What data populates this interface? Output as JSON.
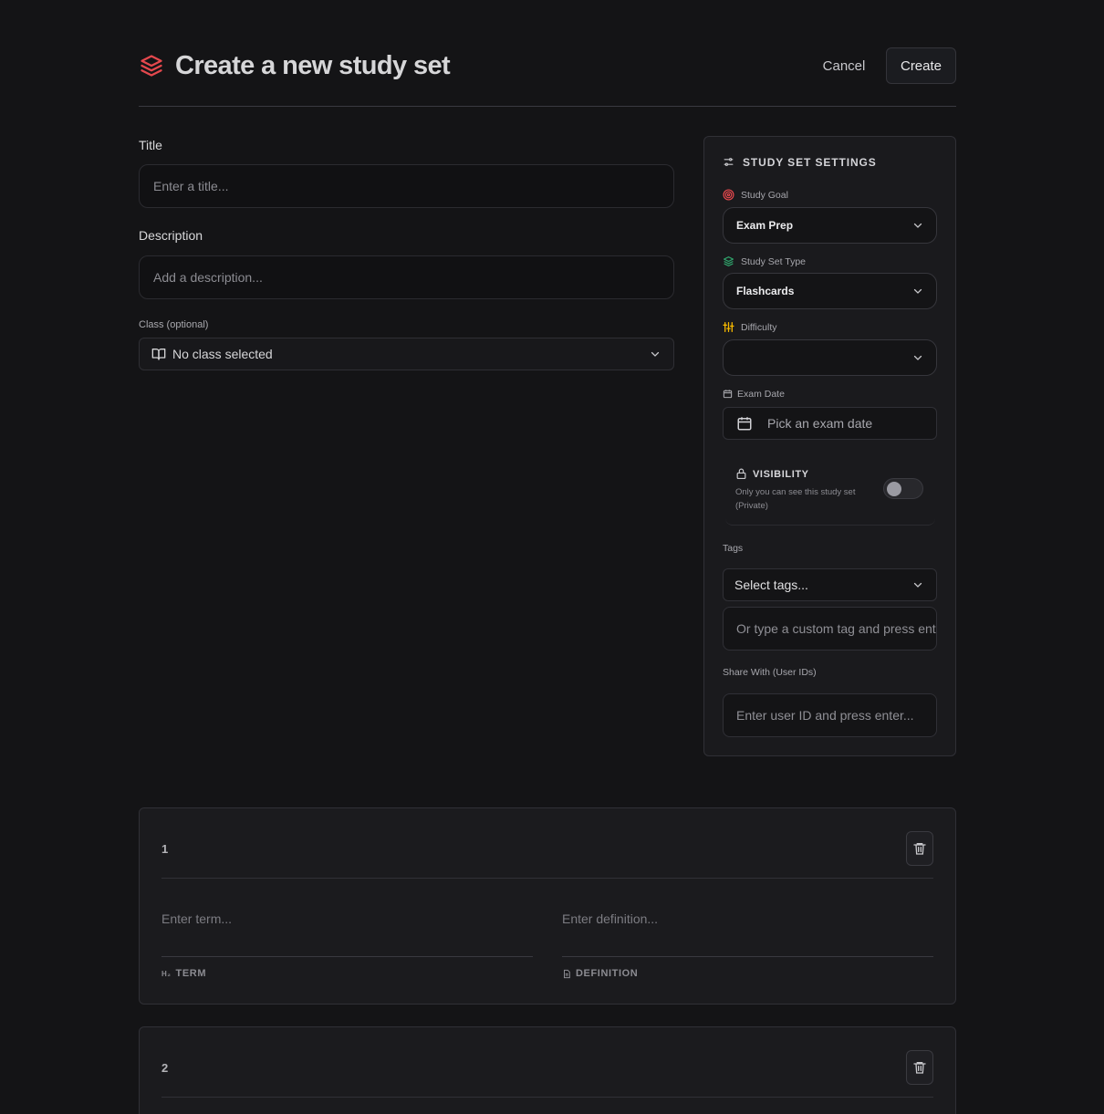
{
  "header": {
    "title": "Create a new study set",
    "cancel_label": "Cancel",
    "create_label": "Create"
  },
  "form": {
    "title_label": "Title",
    "title_placeholder": "Enter a title...",
    "description_label": "Description",
    "description_placeholder": "Add a description...",
    "class_label": "Class (optional)",
    "class_value": "No class selected"
  },
  "settings": {
    "heading": "STUDY SET SETTINGS",
    "study_goal_label": "Study Goal",
    "study_goal_value": "Exam Prep",
    "study_set_type_label": "Study Set Type",
    "study_set_type_value": "Flashcards",
    "difficulty_label": "Difficulty",
    "difficulty_value": "",
    "exam_date_label": "Exam Date",
    "exam_date_placeholder": "Pick an exam date",
    "visibility_label": "VISIBILITY",
    "visibility_desc": "Only you can see this study set (Private)",
    "visibility_on": false,
    "tags_label": "Tags",
    "tags_select_placeholder": "Select tags...",
    "custom_tag_placeholder": "Or type a custom tag and press enter",
    "share_label": "Share With (User IDs)",
    "share_placeholder": "Enter user ID and press enter..."
  },
  "cards": [
    {
      "number": "1",
      "term_placeholder": "Enter term...",
      "definition_placeholder": "Enter definition...",
      "term_tag": "TERM",
      "definition_tag": "DEFINITION"
    },
    {
      "number": "2"
    }
  ],
  "colors": {
    "brand": "#e5484d",
    "goal_icon": "#e5484d",
    "type_icon": "#30a46c",
    "difficulty_icon": "#f5b800"
  }
}
